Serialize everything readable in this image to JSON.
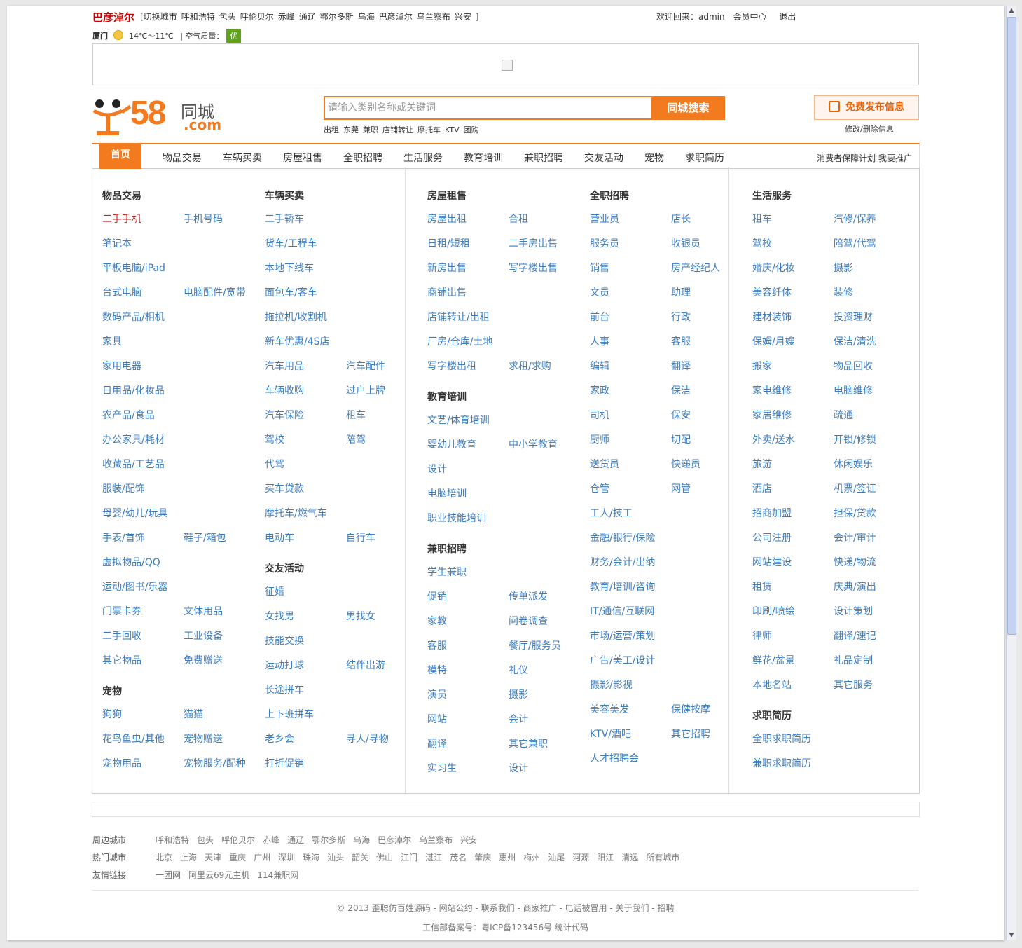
{
  "topbar": {
    "city": "巴彦淖尔",
    "switch_label": "[切换城市",
    "nearby": [
      "呼和浩特",
      "包头",
      "呼伦贝尔",
      "赤峰",
      "通辽",
      "鄂尔多斯",
      "乌海",
      "巴彦淖尔",
      "乌兰察布",
      "兴安"
    ],
    "bracket_end": "]",
    "welcome": "欢迎回来：admin",
    "member_center": "会员中心",
    "logout": "退出"
  },
  "weather": {
    "city": "厦门",
    "temp": "14℃～11℃",
    "aq_label": "| 空气质量：",
    "aq_value": "优",
    "aq_color": "#5fa31a"
  },
  "logo": {
    "num": "58",
    "cn": "同城",
    "domain": ".com"
  },
  "search": {
    "placeholder": "请输入类别名称或关键词",
    "button": "同城搜索",
    "hot": [
      "出租",
      "东莞",
      "兼职",
      "店铺转让",
      "摩托车",
      "KTV",
      "团购"
    ]
  },
  "post": {
    "button": "免费发布信息",
    "edit": "修改/删除信息"
  },
  "nav": {
    "home": "首页",
    "items": [
      "物品交易",
      "车辆买卖",
      "房屋租售",
      "全职招聘",
      "生活服务",
      "教育培训",
      "兼职招聘",
      "交友活动",
      "宠物",
      "求职简历"
    ],
    "right": "消费者保障计划 我要推广"
  },
  "sections": {
    "goods": {
      "title": "物品交易",
      "links": [
        "二手手机",
        "手机号码",
        "笔记本",
        "平板电脑/iPad",
        "台式电脑",
        "电脑配件/宽带",
        "数码产品/相机",
        "家具",
        "家用电器",
        "日用品/化妆品",
        "农产品/食品",
        "办公家具/耗材",
        "收藏品/工艺品",
        "服装/配饰",
        "母婴/幼儿/玩具",
        "手表/首饰",
        "鞋子/箱包",
        "虚拟物品/QQ",
        "运动/图书/乐器",
        "门票卡券",
        "文体用品",
        "二手回收",
        "工业设备",
        "其它物品",
        "免费赠送"
      ]
    },
    "pets": {
      "title": "宠物",
      "links": [
        "狗狗",
        "猫猫",
        "花鸟鱼虫/其他",
        "宠物赠送",
        "宠物用品",
        "宠物服务/配种"
      ]
    },
    "cars": {
      "title": "车辆买卖",
      "links": [
        "二手轿车",
        "货车/工程车",
        "本地下线车",
        "面包车/客车",
        "拖拉机/收割机",
        "新车优惠/4S店",
        "汽车用品",
        "汽车配件",
        "车辆收购",
        "过户上牌",
        "汽车保险",
        "租车",
        "驾校",
        "陪驾",
        "代驾",
        "买车贷款",
        "摩托车/燃气车",
        "电动车",
        "自行车"
      ]
    },
    "dating": {
      "title": "交友活动",
      "links": [
        "征婚",
        "女找男",
        "男找女",
        "技能交换",
        "运动打球",
        "结伴出游",
        "长途拼车",
        "上下班拼车",
        "老乡会",
        "寻人/寻物",
        "打折促销"
      ]
    },
    "house": {
      "title": "房屋租售",
      "links": [
        "房屋出租",
        "合租",
        "日租/短租",
        "二手房出售",
        "新房出售",
        "写字楼出售",
        "商铺出售",
        "店铺转让/出租",
        "厂房/仓库/土地",
        "写字楼出租",
        "求租/求购"
      ]
    },
    "edu": {
      "title": "教育培训",
      "links": [
        "文艺/体育培训",
        "婴幼儿教育",
        "中小学教育",
        "设计",
        "电脑培训",
        "职业技能培训"
      ]
    },
    "parttime": {
      "title": "兼职招聘",
      "links": [
        "学生兼职",
        "促销",
        "传单派发",
        "家教",
        "问卷调查",
        "客服",
        "餐厅/服务员",
        "模特",
        "礼仪",
        "演员",
        "摄影",
        "网站",
        "会计",
        "翻译",
        "其它兼职",
        "实习生",
        "设计"
      ]
    },
    "fulltime": {
      "title": "全职招聘",
      "links": [
        "营业员",
        "店长",
        "服务员",
        "收银员",
        "销售",
        "房产经纪人",
        "文员",
        "助理",
        "前台",
        "行政",
        "人事",
        "客服",
        "编辑",
        "翻译",
        "家政",
        "保洁",
        "司机",
        "保安",
        "厨师",
        "切配",
        "送货员",
        "快递员",
        "仓管",
        "网管",
        "工人/技工",
        "金融/银行/保险",
        "财务/会计/出纳",
        "教育/培训/咨询",
        "IT/通信/互联网",
        "市场/运营/策划",
        "广告/美工/设计",
        "摄影/影视",
        "美容美发",
        "保健按摩",
        "KTV/酒吧",
        "其它招聘",
        "人才招聘会"
      ]
    },
    "life": {
      "title": "生活服务",
      "links": [
        "租车",
        "汽修/保养",
        "驾校",
        "陪驾/代驾",
        "婚庆/化妆",
        "摄影",
        "美容纤体",
        "装修",
        "建材装饰",
        "投资理财",
        "保姆/月嫂",
        "保洁/清洗",
        "搬家",
        "物品回收",
        "家电维修",
        "电脑维修",
        "家居维修",
        "疏通",
        "外卖/送水",
        "开锁/修锁",
        "旅游",
        "休闲娱乐",
        "酒店",
        "机票/签证",
        "招商加盟",
        "担保/贷款",
        "公司注册",
        "会计/审计",
        "网站建设",
        "快递/物流",
        "租赁",
        "庆典/演出",
        "印刷/喷绘",
        "设计策划",
        "律师",
        "翻译/速记",
        "鲜花/盆景",
        "礼品定制",
        "本地名站",
        "其它服务"
      ]
    },
    "resume": {
      "title": "求职简历",
      "links": [
        "全职求职简历",
        "兼职求职简历"
      ]
    }
  },
  "footer": {
    "nearby_label": "周边城市",
    "nearby": [
      "呼和浩特",
      "包头",
      "呼伦贝尔",
      "赤峰",
      "通辽",
      "鄂尔多斯",
      "乌海",
      "巴彦淖尔",
      "乌兰察布",
      "兴安"
    ],
    "hot_label": "热门城市",
    "hot": [
      "北京",
      "上海",
      "天津",
      "重庆",
      "广州",
      "深圳",
      "珠海",
      "汕头",
      "韶关",
      "佛山",
      "江门",
      "湛江",
      "茂名",
      "肇庆",
      "惠州",
      "梅州",
      "汕尾",
      "河源",
      "阳江",
      "清远",
      "所有城市"
    ],
    "friend_label": "友情链接",
    "friends": [
      "一团网",
      "阿里云69元主机",
      "114兼职网"
    ],
    "copyright": "© 2013 歪聪仿百姓源码 - 网站公约 - 联系我们 - 商家推广 - 电话被冒用 - 关于我们 - 招聘",
    "icp": "工信部备案号：粤ICP备123456号 统计代码"
  }
}
